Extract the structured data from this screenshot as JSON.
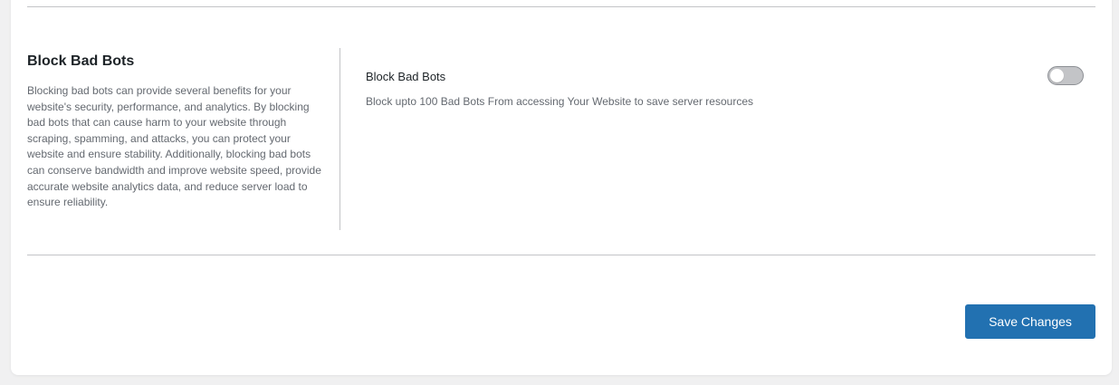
{
  "section": {
    "title": "Block Bad Bots",
    "description": "Blocking bad bots can provide several benefits for your website's security, performance, and analytics. By blocking bad bots that can cause harm to your website through scraping, spamming, and attacks, you can protect your website and ensure stability. Additionally, blocking bad bots can conserve bandwidth and improve website speed, provide accurate website analytics data, and reduce server load to ensure reliability."
  },
  "setting": {
    "label": "Block Bad Bots",
    "description": "Block upto 100 Bad Bots From accessing Your Website to save server resources",
    "enabled": false
  },
  "actions": {
    "save_label": "Save Changes"
  },
  "colors": {
    "primary": "#2271b1",
    "toggle_off": "#c3c4c7",
    "background": "#f0f0f1"
  }
}
